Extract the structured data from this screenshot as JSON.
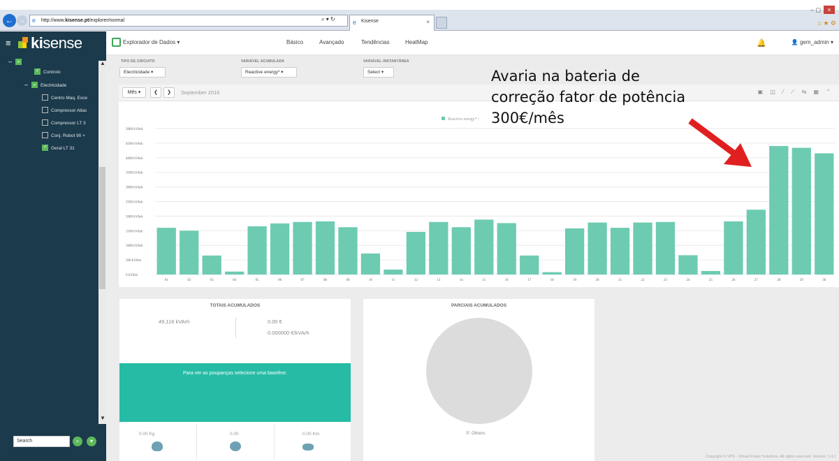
{
  "browser": {
    "url_prefix": "http://www.",
    "url_domain": "kisense.pt",
    "url_path": "/explorer/normal",
    "address_controls": "⌕ ▾ ↻",
    "tab_title": "Kisense",
    "tab_close": "×",
    "window_controls": "–  ◻",
    "window_close": "×",
    "right_icons": "⌂ ★ ⚙"
  },
  "app": {
    "logo": "kisense",
    "logo_bold": "ki",
    "logo_light": "sense",
    "menu_icon": "≡",
    "explorer_label": "Explorador de Dados ▾",
    "tabs": [
      {
        "label": "Básico"
      },
      {
        "label": "Avançado"
      },
      {
        "label": "Tendências"
      },
      {
        "label": "HeatMap"
      }
    ],
    "bell_icon": "🔔",
    "user_label": "gem_admin ▾",
    "user_icon": "👤"
  },
  "sidebar": {
    "items": [
      {
        "label": "",
        "toggle": "–",
        "state": "partial"
      },
      {
        "label": "Controlo",
        "toggle": "",
        "state": "checked"
      },
      {
        "label": "Electricidade",
        "toggle": "–",
        "state": "partial"
      },
      {
        "label": "Centro Maq. Exce",
        "toggle": "",
        "state": "unchecked"
      },
      {
        "label": "Compressor Atlas",
        "toggle": "",
        "state": "unchecked"
      },
      {
        "label": "Compressor LT 3",
        "toggle": "",
        "state": "unchecked"
      },
      {
        "label": "Conj. Robot 90 +",
        "toggle": "",
        "state": "unchecked"
      },
      {
        "label": "Geral LT 31",
        "toggle": "",
        "state": "checked"
      }
    ],
    "search_value": "Search",
    "scroll_up": "▲",
    "scroll_down": "▼",
    "search_btn_icon": "🔍",
    "filter_btn_icon": "⏷"
  },
  "controls": {
    "circuit_type_label": "TIPO DE CIRCUITO",
    "circuit_type_value": "Electricidade ▾",
    "acc_var_label": "VARIÁVEL ACUMULADA",
    "acc_var_value": "Reactive energy* ▾",
    "inst_var_label": "VARIÁVEL INSTANTÂNEA",
    "inst_var_value": "Select ▾"
  },
  "chart_toolbar": {
    "period_select": "Mês ▾",
    "prev": "❮",
    "next": "❯",
    "period_label": "September 2016",
    "icons": "▣ ◫ ⁄ ⟋ ⇆ ▦ ⌃"
  },
  "chart_data": {
    "type": "bar",
    "legend": "Reactive energy* (kVArh)",
    "legend_visible": "Reactive energy* / ",
    "categories": [
      "01",
      "02",
      "03",
      "04",
      "05",
      "06",
      "07",
      "08",
      "09",
      "10",
      "11",
      "12",
      "13",
      "14",
      "15",
      "16",
      "17",
      "18",
      "19",
      "20",
      "21",
      "22",
      "23",
      "24",
      "25",
      "26",
      "27",
      "28",
      "29",
      "30"
    ],
    "values": [
      1600,
      1500,
      650,
      100,
      1650,
      1750,
      1800,
      1820,
      1620,
      720,
      170,
      1460,
      1800,
      1620,
      1880,
      1760,
      650,
      80,
      1580,
      1780,
      1600,
      1780,
      1800,
      660,
      120,
      1820,
      2220,
      4400,
      4340,
      4150
    ],
    "ylim": [
      0,
      5000
    ],
    "yticks": [
      0,
      500,
      1000,
      1500,
      2000,
      2500,
      3000,
      3500,
      4000,
      4500,
      5000
    ],
    "ytick_labels": [
      "0 kVArh",
      "500 kVArh",
      "1000 kVArh",
      "1500 kVArh",
      "2000 kVArh",
      "2500 kVArh",
      "3000 kVArh",
      "3500 kVArh",
      "4000 kVArh",
      "4500 kVArh",
      "5000 kVArh"
    ],
    "bar_color": "#6dcbb1",
    "grid": true
  },
  "annotation": {
    "line1": "Avaria na bateria de",
    "line2": "correção fator de potência",
    "line3": "300€/mês",
    "arrow_color": "#e02020"
  },
  "totals": {
    "title": "TOTAIS ACUMULADOS",
    "kvarh": "49,116 kVArh",
    "eur": "0.00 €",
    "eur_per_kvarh": "0.000000 €/kVArh",
    "baseline_msg": "Para ver as poupanças selecione uma baseline.",
    "co2": "0.00 Kg",
    "trees": "0.00",
    "km": "0.00 Km"
  },
  "partials": {
    "title": "PARCIAIS ACUMULADOS",
    "legend": "Others"
  },
  "footer": {
    "copyright": "Copyright © VPS - Virtual Power Solutions, All rights reserved. Version: 1.4.1"
  }
}
